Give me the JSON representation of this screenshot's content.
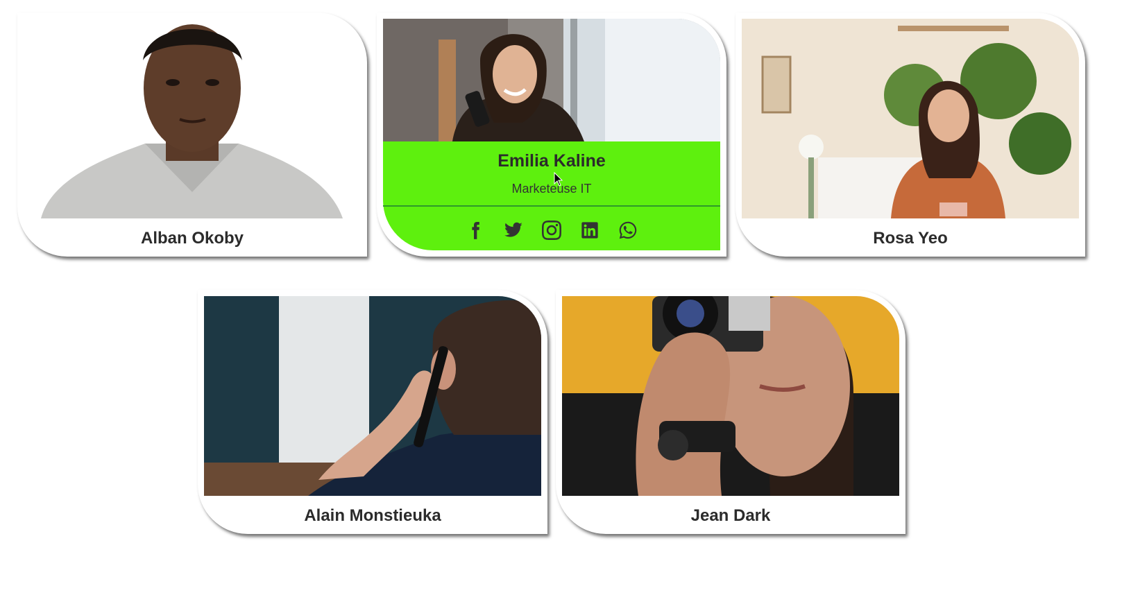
{
  "team": [
    {
      "name": "Alban Okoby",
      "photo": "portrait-man-white-background"
    },
    {
      "name": "Emilia Kaline",
      "role": "Marketeuse IT",
      "photo": "woman-on-phone-by-window",
      "socials": [
        "facebook-icon",
        "twitter-icon",
        "instagram-icon",
        "linkedin-icon",
        "whatsapp-icon"
      ]
    },
    {
      "name": "Rosa Yeo",
      "photo": "woman-at-laptop-with-plants"
    },
    {
      "name": "Alain Monstieuka",
      "photo": "man-on-phone-from-behind"
    },
    {
      "name": "Jean Dark",
      "photo": "woman-with-camera"
    }
  ],
  "colors": {
    "hover_panel": "#5ef00e",
    "text": "#2b2b2b",
    "card_bg": "#ffffff"
  }
}
